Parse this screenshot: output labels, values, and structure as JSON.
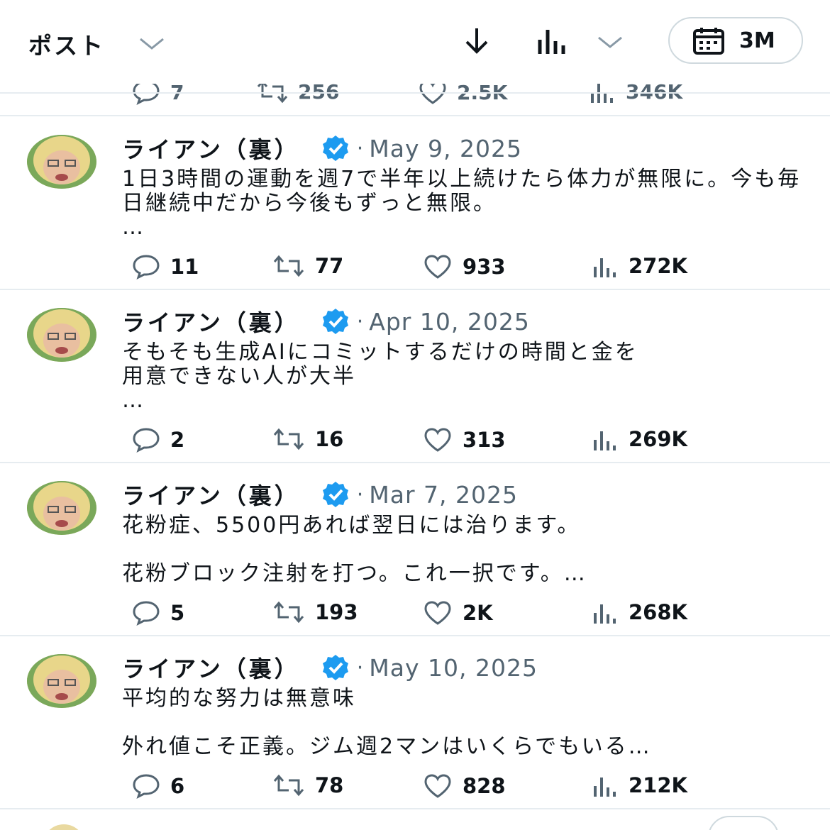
{
  "header": {
    "title": "ポスト",
    "range_label": "3M"
  },
  "partial_top_post": {
    "replies": "7",
    "reposts": "256",
    "likes": "2.5K",
    "views": "346K"
  },
  "posts": [
    {
      "author": "ライアン（裏）",
      "date": "May 9, 2025",
      "text": "1日3時間の運動を週7で半年以上続けたら体力が無限に。今も毎日継続中だから今後もずっと無限。\n…",
      "replies": "11",
      "reposts": "77",
      "likes": "933",
      "views": "272K"
    },
    {
      "author": "ライアン（裏）",
      "date": "Apr 10, 2025",
      "text": "そもそも生成AIにコミットするだけの時間と金を\n用意できない人が大半\n…",
      "replies": "2",
      "reposts": "16",
      "likes": "313",
      "views": "269K"
    },
    {
      "author": "ライアン（裏）",
      "date": "Mar 7, 2025",
      "text": "花粉症、5500円あれば翌日には治ります。\n\n花粉ブロック注射を打つ。これ一択です。…",
      "replies": "5",
      "reposts": "193",
      "likes": "2K",
      "views": "268K"
    },
    {
      "author": "ライアン（裏）",
      "date": "May 10, 2025",
      "text": "平均的な努力は無意味\n\n外れ値こそ正義。ジム週2マンはいくらでもいる…",
      "replies": "6",
      "reposts": "78",
      "likes": "828",
      "views": "212K"
    }
  ],
  "colors": {
    "verified": "#1d9bf0",
    "text_primary": "#0f1419",
    "text_secondary": "#536471",
    "divider": "#e6ecf0"
  },
  "icons": {
    "reply": "speech-bubble-icon",
    "repost": "repost-icon",
    "like": "heart-icon",
    "views": "bar-chart-icon",
    "download": "download-arrow-icon",
    "calendar": "calendar-icon",
    "verified": "verified-badge-icon"
  }
}
